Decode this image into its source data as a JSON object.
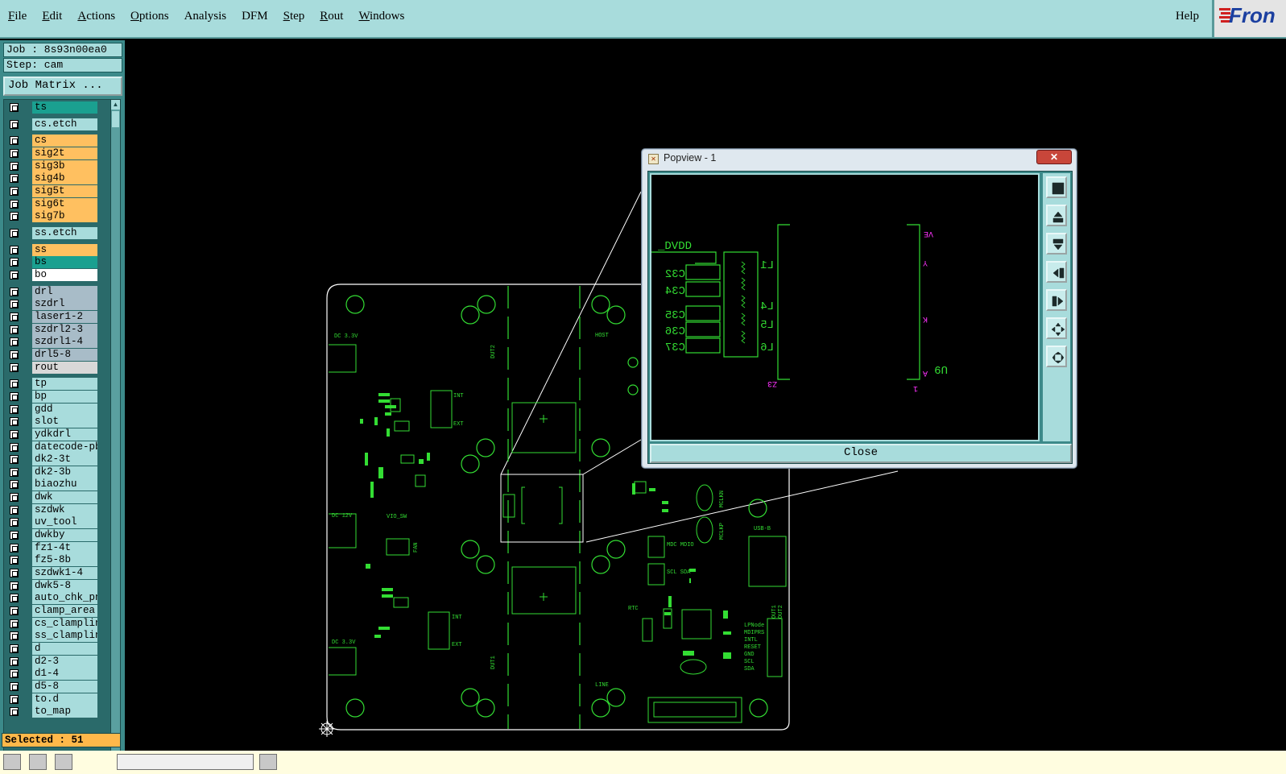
{
  "menubar": {
    "items": [
      {
        "label": "File",
        "key": "F",
        "rest": "ile"
      },
      {
        "label": "Edit",
        "key": "E",
        "rest": "dit"
      },
      {
        "label": "Actions",
        "key": "A",
        "rest": "ctions"
      },
      {
        "label": "Options",
        "key": "O",
        "rest": "ptions"
      },
      {
        "label": "Analysis",
        "key": "",
        "rest": "Analysis"
      },
      {
        "label": "DFM",
        "key": "",
        "rest": "DFM"
      },
      {
        "label": "Step",
        "key": "S",
        "rest": "tep"
      },
      {
        "label": "Rout",
        "key": "R",
        "rest": "out"
      },
      {
        "label": "Windows",
        "key": "W",
        "rest": "indows"
      }
    ],
    "help": "Help",
    "logo": "Fron"
  },
  "leftpanel": {
    "job": "Job : 8s93n00ea0",
    "step": "Step: cam",
    "job_matrix": "Job Matrix ...",
    "selected": "Selected : 51"
  },
  "layers": [
    {
      "name": "ts",
      "color": "#1aa090"
    },
    {
      "name": "cs.etch",
      "color": "#a8dcdc"
    },
    {
      "name": "cs",
      "color": "#ffc060"
    },
    {
      "name": "sig2t",
      "color": "#ffc060"
    },
    {
      "name": "sig3b",
      "color": "#ffc060"
    },
    {
      "name": "sig4b",
      "color": "#ffc060"
    },
    {
      "name": "sig5t",
      "color": "#ffc060"
    },
    {
      "name": "sig6t",
      "color": "#ffc060"
    },
    {
      "name": "sig7b",
      "color": "#ffc060"
    },
    {
      "name": "ss.etch",
      "color": "#a8dcdc"
    },
    {
      "name": "ss",
      "color": "#ffc060"
    },
    {
      "name": "bs",
      "color": "#1aa090"
    },
    {
      "name": "bo",
      "color": "#ffffff"
    },
    {
      "name": "drl",
      "color": "#a8bcc8"
    },
    {
      "name": "szdrl",
      "color": "#a8bcc8"
    },
    {
      "name": "laser1-2",
      "color": "#a8bcc8"
    },
    {
      "name": "szdrl2-3",
      "color": "#a8bcc8"
    },
    {
      "name": "szdrl1-4",
      "color": "#a8bcc8"
    },
    {
      "name": "drl5-8",
      "color": "#a8bcc8"
    },
    {
      "name": "rout",
      "color": "#d8d8d8"
    },
    {
      "name": "tp",
      "color": "#a8dcdc"
    },
    {
      "name": "bp",
      "color": "#a8dcdc"
    },
    {
      "name": "gdd",
      "color": "#a8dcdc"
    },
    {
      "name": "slot",
      "color": "#a8dcdc"
    },
    {
      "name": "ydkdrl",
      "color": "#a8dcdc"
    },
    {
      "name": "datecode-pbe",
      "color": "#a8dcdc"
    },
    {
      "name": "dk2-3t",
      "color": "#a8dcdc"
    },
    {
      "name": "dk2-3b",
      "color": "#a8dcdc"
    },
    {
      "name": "biaozhu",
      "color": "#a8dcdc"
    },
    {
      "name": "dwk",
      "color": "#a8dcdc"
    },
    {
      "name": "szdwk",
      "color": "#a8dcdc"
    },
    {
      "name": "uv_tool",
      "color": "#a8dcdc"
    },
    {
      "name": "dwkby",
      "color": "#a8dcdc"
    },
    {
      "name": "fz1-4t",
      "color": "#a8dcdc"
    },
    {
      "name": "fz5-8b",
      "color": "#a8dcdc"
    },
    {
      "name": "szdwk1-4",
      "color": "#a8dcdc"
    },
    {
      "name": "dwk5-8",
      "color": "#a8dcdc"
    },
    {
      "name": "auto_chk_pn",
      "color": "#a8dcdc"
    },
    {
      "name": "clamp_area",
      "color": "#a8dcdc"
    },
    {
      "name": "cs_clampline",
      "color": "#a8dcdc"
    },
    {
      "name": "ss_clampline",
      "color": "#a8dcdc"
    },
    {
      "name": "d",
      "color": "#a8dcdc"
    },
    {
      "name": "d2-3",
      "color": "#a8dcdc"
    },
    {
      "name": "d1-4",
      "color": "#a8dcdc"
    },
    {
      "name": "d5-8",
      "color": "#a8dcdc"
    },
    {
      "name": "to.d",
      "color": "#a8dcdc"
    },
    {
      "name": "to_map",
      "color": "#a8dcdc"
    }
  ],
  "board": {
    "outline_color": "#ffffff",
    "trace_color": "#33dd33",
    "magenta_color": "#ff33ff",
    "labels": {
      "dc33_top": "DC 3.3V",
      "dc12": "DC 12V",
      "dc33_bot": "DC 3.3V",
      "dut2": "DUT2",
      "dut1": "DUT1",
      "host": "HOST",
      "line": "LINE",
      "usb_b": "USB-B",
      "int1": "INT",
      "ext1": "EXT",
      "int2": "INT",
      "ext2": "EXT",
      "mdc_mdio": "MDC MDIO",
      "scl_sda": "SCL SDA",
      "lpnode": "LPNode",
      "mdppr": "MDIPRS",
      "intl": "INTL",
      "reset": "RESET",
      "gnd": "GND",
      "scl": "SCL",
      "sda": "SDA",
      "out1": "OUT1",
      "out2": "OUT2",
      "mclkn": "MCLKN",
      "mclkp": "MCLKP",
      "fan": "FAN",
      "vio_sw": "VIO_SW",
      "rtc": "RTC"
    }
  },
  "popview": {
    "title": "Popview - 1",
    "close_label": "Close",
    "labels": {
      "dvdd": "_DVDD",
      "c32": "C32",
      "c34": "C34",
      "c35": "C35",
      "c36": "C36",
      "c37": "C37",
      "l1": "L1",
      "l4": "L4",
      "l5": "L5",
      "l6": "L6",
      "z3": "Z3",
      "u9": "U9",
      "a": "A",
      "y": "Y",
      "k": "K",
      "a_bot": "A",
      "ve": "VE",
      "one": "1",
      "three": "3"
    }
  }
}
